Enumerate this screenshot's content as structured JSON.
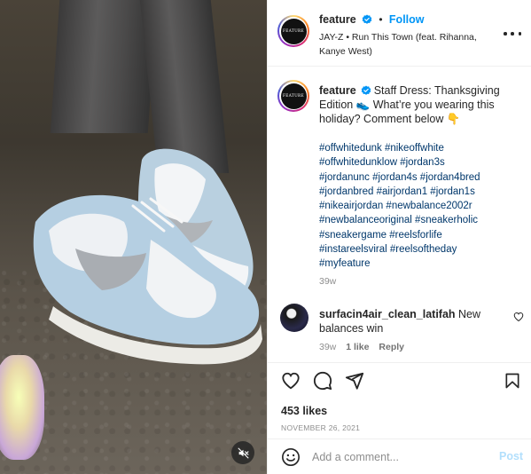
{
  "post": {
    "username": "feature",
    "follow_label": "Follow",
    "separator": "•",
    "audio_line1": "JAY-Z • Run This Town (feat. Rihanna,",
    "audio_line2": "Kanye West)",
    "avatar_logo_text": "FEATURE"
  },
  "caption": {
    "username": "feature",
    "text": "Staff Dress: Thanksgiving Edition 👟 What’re you wearing this holiday? Comment below 👇",
    "hashtag_lines": [
      "#offwhitedunk #nikeoffwhite",
      "#offwhitedunklow #jordan3s",
      "#jordanunc #jordan4s #jordan4bred",
      "#jordanbred #airjordan1 #jordan1s",
      "#nikeairjordan #newbalance2002r",
      "#newbalanceoriginal #sneakerholic",
      "#sneakergame #reelsforlife",
      "#instareelsviral #reelsoftheday",
      "#myfeature"
    ],
    "age": "39w"
  },
  "comment": {
    "username": "surfacin4air_clean_latifah",
    "text": "New balances win",
    "age": "39w",
    "likes": "1 like",
    "reply_label": "Reply"
  },
  "stats": {
    "likes": "453 likes",
    "date": "NOVEMBER 26, 2021"
  },
  "composer": {
    "placeholder": "Add a comment...",
    "post_label": "Post"
  },
  "colors": {
    "accent": "#0095f6",
    "hashtag": "#00376b",
    "post_disabled": "#b2dffc",
    "muted_text": "#8e8e8e"
  },
  "icons": {
    "verified": "verified-badge-icon",
    "more": "more-options-icon",
    "heart": "heart-icon",
    "comment": "comment-icon",
    "share": "share-icon",
    "save": "bookmark-icon",
    "emoji": "emoji-icon",
    "mute": "muted-speaker-icon"
  }
}
